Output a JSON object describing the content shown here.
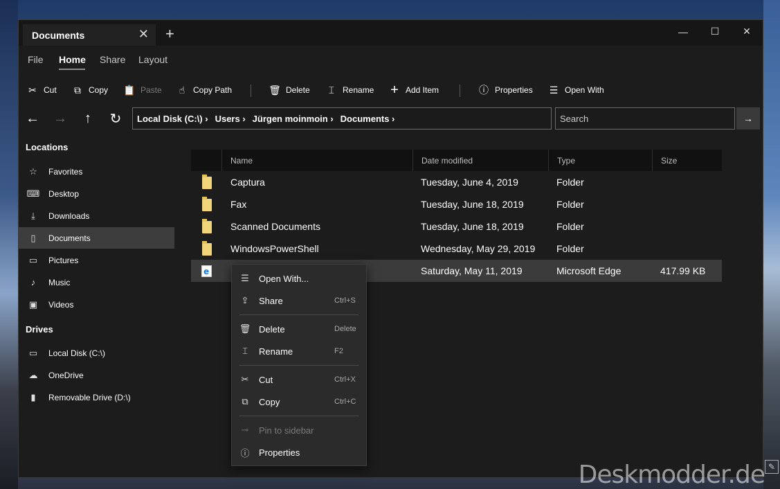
{
  "window": {
    "tab_title": "Documents",
    "tab_close": "✕",
    "new_tab": "+",
    "minimize": "—",
    "maximize": "☐",
    "close": "✕"
  },
  "menu": {
    "items": [
      "File",
      "Home",
      "Share",
      "Layout"
    ],
    "active": "Home"
  },
  "toolbar": {
    "cut": "Cut",
    "copy": "Copy",
    "paste": "Paste",
    "copy_path": "Copy Path",
    "delete": "Delete",
    "rename": "Rename",
    "add_item": "Add Item",
    "properties": "Properties",
    "open_with": "Open With"
  },
  "nav": {
    "crumbs": [
      "Local Disk (C:\\) ›",
      "Users ›",
      "Jürgen moinmoin ›",
      "Documents ›"
    ],
    "search_placeholder": "Search"
  },
  "sidebar": {
    "locations_header": "Locations",
    "locations": [
      "Favorites",
      "Desktop",
      "Downloads",
      "Documents",
      "Pictures",
      "Music",
      "Videos"
    ],
    "selected": "Documents",
    "drives_header": "Drives",
    "drives": [
      "Local Disk (C:\\)",
      "OneDrive",
      "Removable Drive (D:\\)"
    ]
  },
  "list": {
    "columns": [
      "Name",
      "Date modified",
      "Type",
      "Size"
    ],
    "rows": [
      {
        "name": "Captura",
        "date": "Tuesday, June 4, 2019",
        "type": "Folder",
        "size": ""
      },
      {
        "name": "Fax",
        "date": "Tuesday, June 18, 2019",
        "type": "Folder",
        "size": ""
      },
      {
        "name": "Scanned Documents",
        "date": "Tuesday, June 18, 2019",
        "type": "Folder",
        "size": ""
      },
      {
        "name": "WindowsPowerShell",
        "date": "Wednesday, May 29, 2019",
        "type": "Folder",
        "size": ""
      },
      {
        "name": "",
        "date": "Saturday, May 11, 2019",
        "type": "Microsoft Edge",
        "size": "417.99 KB"
      }
    ]
  },
  "context_menu": {
    "open_with": "Open With...",
    "share": "Share",
    "share_key": "Ctrl+S",
    "delete": "Delete",
    "delete_key": "Delete",
    "rename": "Rename",
    "rename_key": "F2",
    "cut": "Cut",
    "cut_key": "Ctrl+X",
    "copy": "Copy",
    "copy_key": "Ctrl+C",
    "pin": "Pin to sidebar",
    "properties": "Properties"
  },
  "watermark": "Deskmodder.de"
}
